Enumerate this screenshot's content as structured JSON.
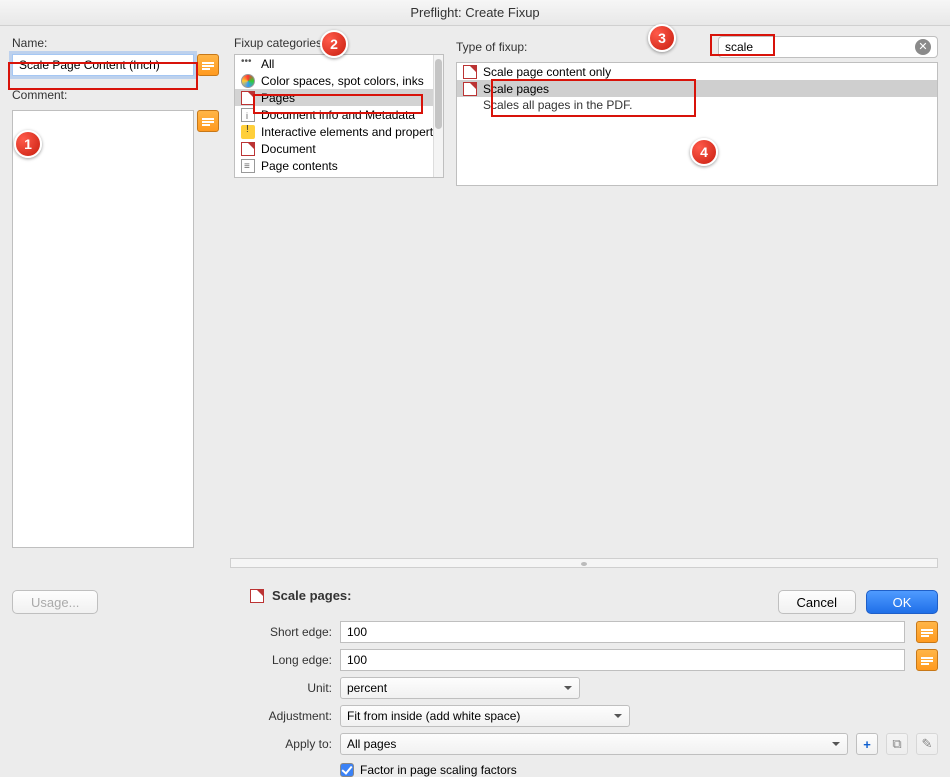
{
  "window_title": "Preflight: Create Fixup",
  "left": {
    "name_label": "Name:",
    "name_value": "Scale Page Content (Inch)",
    "comment_label": "Comment:"
  },
  "categories": {
    "label": "Fixup categories:",
    "items": [
      "All",
      "Color spaces, spot colors, inks",
      "Pages",
      "Document info and Metadata",
      "Interactive elements and properties",
      "Document",
      "Page contents"
    ]
  },
  "fixup": {
    "label": "Type of fixup:",
    "search": "scale",
    "items": [
      "Scale page content only",
      "Scale pages"
    ],
    "selected_desc": "Scales all pages in the PDF."
  },
  "settings": {
    "title": "Scale pages:",
    "short_edge_label": "Short edge:",
    "short_edge_value": "100",
    "long_edge_label": "Long edge:",
    "long_edge_value": "100",
    "unit_label": "Unit:",
    "unit_value": "percent",
    "adjustment_label": "Adjustment:",
    "adjustment_value": "Fit from inside (add white space)",
    "applyto_label": "Apply to:",
    "applyto_value": "All pages",
    "checkbox_label": "Factor in page scaling factors"
  },
  "footer": {
    "usage": "Usage...",
    "cancel": "Cancel",
    "ok": "OK"
  },
  "callouts": {
    "c1": "1",
    "c2": "2",
    "c3": "3",
    "c4": "4"
  }
}
